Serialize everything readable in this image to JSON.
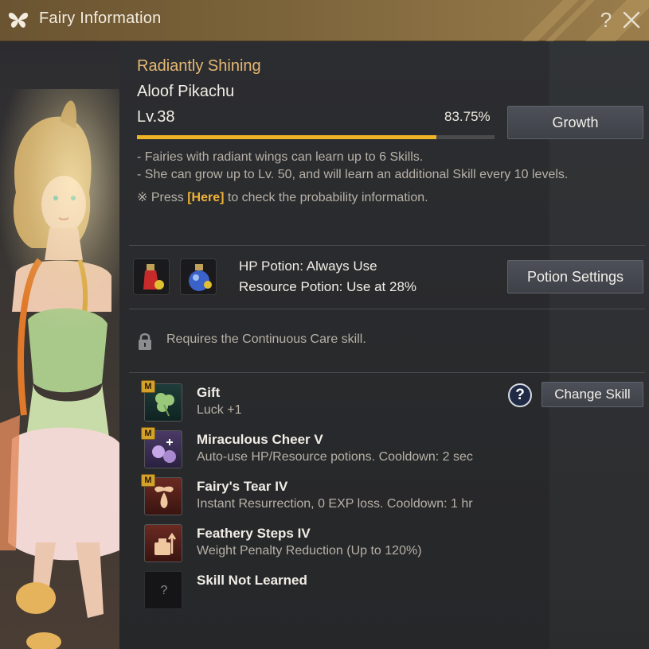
{
  "window": {
    "title": "Fairy Information"
  },
  "titlebar": {
    "help_symbol": "?",
    "close_icon": "close-icon"
  },
  "fairy": {
    "grade": "Radiantly Shining",
    "name": "Aloof Pikachu",
    "level": "Lv.38",
    "exp_percent_text": "83.75%",
    "exp_fraction": 0.8375
  },
  "buttons": {
    "growth": "Growth",
    "potion_settings": "Potion Settings",
    "change_skill": "Change Skill"
  },
  "info": {
    "line1": "- Fairies with radiant wings can learn up to 6 Skills.",
    "line2": "- She can grow up to Lv. 50, and will learn an additional Skill every 10 levels.",
    "line3_prefix": "※ Press ",
    "line3_link": "[Here]",
    "line3_suffix": " to check the probability information."
  },
  "potions": {
    "hp": "HP Potion: Always Use",
    "resource": "Resource Potion: Use at 28%"
  },
  "lock_note": "Requires the Continuous Care skill.",
  "skill_help_symbol": "?",
  "skills": [
    {
      "badge": "M",
      "name": "Gift",
      "desc": "Luck +1",
      "icon": "clover-icon"
    },
    {
      "badge": "M",
      "name": "Miraculous Cheer V",
      "desc": "Auto-use HP/Resource potions. Cooldown: 2 sec",
      "icon": "potion-cheer-icon"
    },
    {
      "badge": "M",
      "name": "Fairy's Tear IV",
      "desc": "Instant Resurrection, 0 EXP loss. Cooldown: 1 hr",
      "icon": "fairy-tear-icon"
    },
    {
      "badge": "",
      "name": "Feathery Steps IV",
      "desc": "Weight Penalty Reduction (Up to 120%)",
      "icon": "weight-icon"
    },
    {
      "badge": "",
      "name": "Skill Not Learned",
      "desc": "",
      "icon": "unknown-icon",
      "placeholder": "?"
    }
  ],
  "colors": {
    "accent_gold": "#f0b526",
    "grade_text": "#e6b873",
    "titlebar": "#7a6239"
  }
}
